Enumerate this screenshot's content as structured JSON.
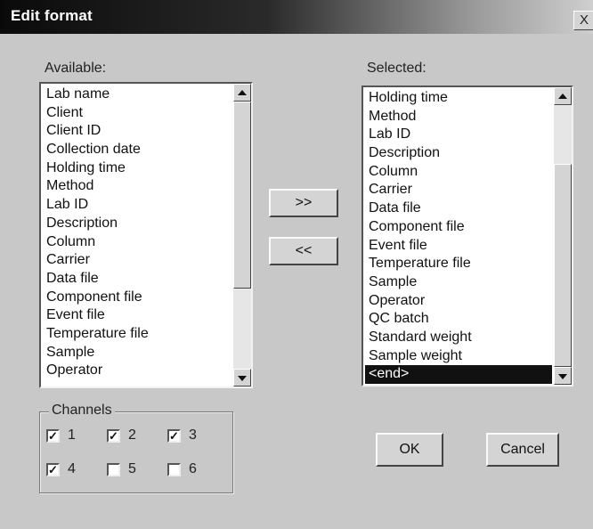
{
  "window": {
    "title": "Edit format",
    "close_label": "X"
  },
  "available": {
    "label": "Available:",
    "items": [
      "Lab name",
      "Client",
      "Client ID",
      "Collection date",
      "Holding time",
      "Method",
      "Lab ID",
      "Description",
      "Column",
      "Carrier",
      "Data file",
      "Component file",
      "Event file",
      "Temperature file",
      "Sample",
      "Operator"
    ]
  },
  "selected": {
    "label": "Selected:",
    "items": [
      "Holding time",
      "Method",
      "Lab ID",
      "Description",
      "Column",
      "Carrier",
      "Data file",
      "Component file",
      "Event file",
      "Temperature file",
      "Sample",
      "Operator",
      "QC batch",
      "Standard weight",
      "Sample weight",
      "<end>"
    ],
    "highlighted_index": 15
  },
  "buttons": {
    "add": ">>",
    "remove": "<<",
    "ok": "OK",
    "cancel": "Cancel"
  },
  "channels": {
    "label": "Channels",
    "items": [
      {
        "label": "1",
        "checked": true
      },
      {
        "label": "2",
        "checked": true
      },
      {
        "label": "3",
        "checked": true
      },
      {
        "label": "4",
        "checked": true
      },
      {
        "label": "5",
        "checked": false
      },
      {
        "label": "6",
        "checked": false
      }
    ]
  }
}
